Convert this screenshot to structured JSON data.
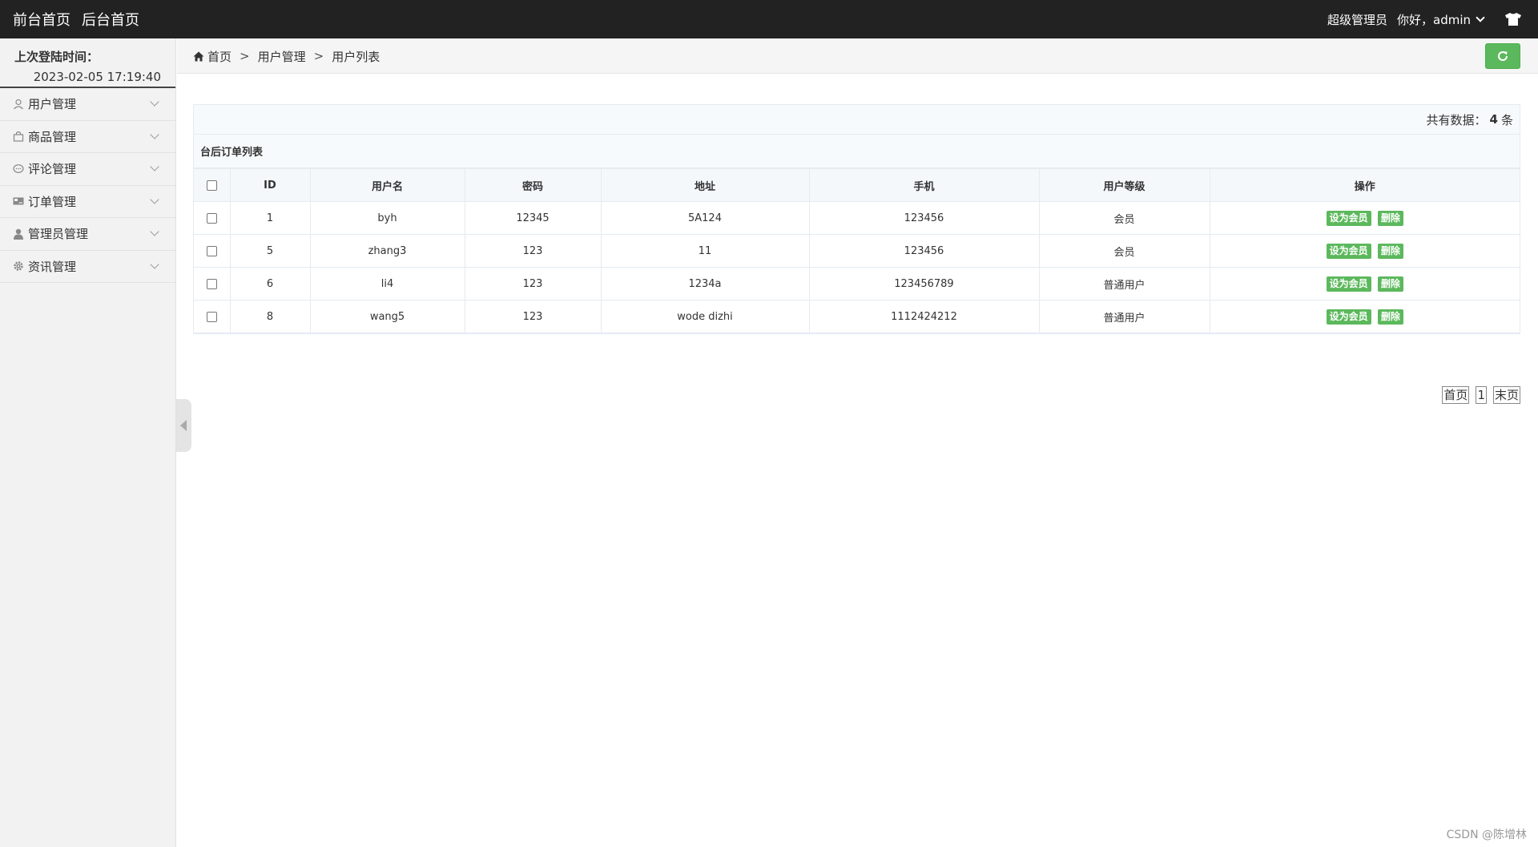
{
  "topbar": {
    "nav": [
      "前台首页",
      "后台首页"
    ],
    "role": "超级管理员",
    "greeting": "你好，admin"
  },
  "sidebar": {
    "login_label": "上次登陆时间：",
    "login_time": "2023-02-05 17:19:40",
    "items": [
      {
        "label": "用户管理",
        "icon": "user-outline-icon"
      },
      {
        "label": "商品管理",
        "icon": "bag-icon"
      },
      {
        "label": "评论管理",
        "icon": "comment-icon"
      },
      {
        "label": "订单管理",
        "icon": "card-icon"
      },
      {
        "label": "管理员管理",
        "icon": "user-icon"
      },
      {
        "label": "资讯管理",
        "icon": "gear-icon"
      }
    ]
  },
  "breadcrumb": [
    "首页",
    "用户管理",
    "用户列表"
  ],
  "count": {
    "prefix": "共有数据：",
    "value": "4",
    "suffix": "条"
  },
  "table": {
    "title": "台后订单列表",
    "headers": [
      "ID",
      "用户名",
      "密码",
      "地址",
      "手机",
      "用户等级",
      "操作"
    ],
    "rows": [
      [
        "1",
        "byh",
        "12345",
        "5A124",
        "123456",
        "会员"
      ],
      [
        "5",
        "zhang3",
        "123",
        "11",
        "123456",
        "会员"
      ],
      [
        "6",
        "li4",
        "123",
        "1234a",
        "123456789",
        "普通用户"
      ],
      [
        "8",
        "wang5",
        "123",
        "wode dizhi",
        "1112424212",
        "普通用户"
      ]
    ],
    "action_set_member": "设为会员",
    "action_delete": "删除"
  },
  "pager": {
    "first": "首页",
    "page": "1",
    "last": "末页"
  },
  "watermark": "CSDN @陈增林",
  "colors": {
    "topbar": "#222222",
    "accent": "#5cb85c"
  }
}
